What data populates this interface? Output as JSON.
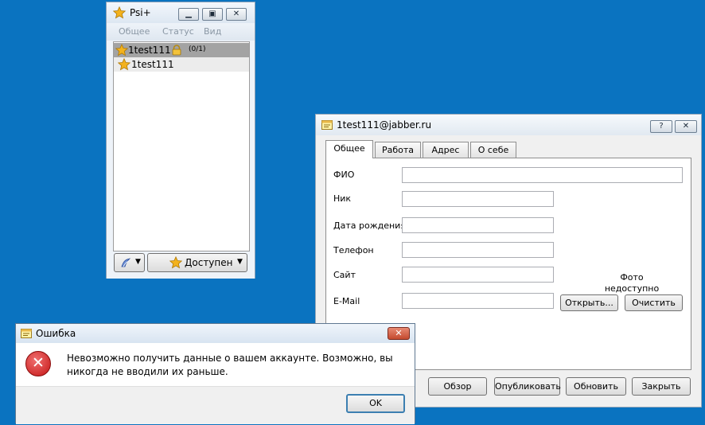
{
  "psi": {
    "title": "Psi+",
    "menu": [
      "Общее",
      "Статус",
      "Вид"
    ],
    "contacts": [
      {
        "name": "1test111",
        "badge": "(0/1)"
      },
      {
        "name": "1test111"
      }
    ],
    "status_button": "Доступен"
  },
  "info": {
    "title": "1test111@jabber.ru",
    "help_button": "?",
    "close_button": "✕",
    "tabs": [
      "Общее",
      "Работа",
      "Адрес",
      "О себе"
    ],
    "fields": {
      "full_name": "ФИО",
      "nick": "Ник",
      "birthday": "Дата рождения",
      "phone": "Телефон",
      "site": "Сайт",
      "email": "E-Mail"
    },
    "photo_line1": "Фото",
    "photo_line2": "недоступно",
    "open_button": "Открыть...",
    "clear_button": "Очистить",
    "buttons": {
      "browse": "Обзор",
      "publish": "Опубликовать",
      "refresh": "Обновить",
      "close": "Закрыть"
    }
  },
  "error": {
    "title": "Ошибка",
    "message": "Невозможно получить данные о вашем аккаунте. Возможно, вы никогда не вводили их раньше.",
    "ok": "OK",
    "close_glyph": "✕",
    "icon_glyph": "✕"
  },
  "colors": {
    "desktop": "#0a73c0",
    "star": "#f3b21d",
    "error_red": "#c41515"
  }
}
